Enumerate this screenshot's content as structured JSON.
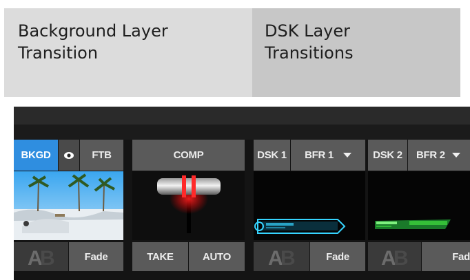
{
  "headers": {
    "background": "Background Layer\nTransition",
    "dsk": "DSK Layer\nTransitions"
  },
  "bkgd": {
    "bkgd_label": "BKGD",
    "eye_icon": "eye-icon",
    "ftb_label": "FTB",
    "ab_icon": "ab-icon",
    "fade_label": "Fade"
  },
  "comp": {
    "comp_label": "COMP",
    "take_label": "TAKE",
    "auto_label": "AUTO"
  },
  "dsk1": {
    "dsk_label": "DSK 1",
    "buffer_label": "BFR 1",
    "dropdown_icon": "chevron-down-icon",
    "ab_icon": "ab-icon",
    "fade_label": "Fade"
  },
  "dsk2": {
    "dsk_label": "DSK 2",
    "buffer_label": "BFR 2",
    "dropdown_icon": "chevron-down-icon",
    "ab_icon": "ab-icon",
    "fade_label": "Fade"
  },
  "colors": {
    "accent_blue": "#2f8ee0",
    "tbar_red": "#ff2020",
    "lower_third_cyan": "#36d4ff",
    "lower_third_green": "#3cd23c"
  }
}
